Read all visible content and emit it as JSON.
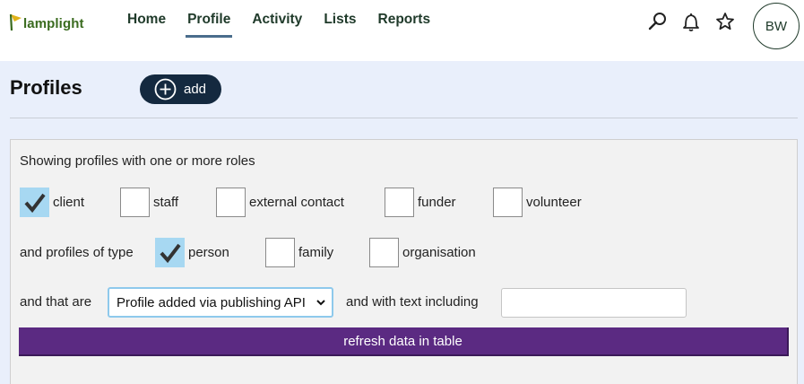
{
  "brand": {
    "name": "lamplight",
    "color": "#3a6b1f"
  },
  "nav": {
    "items": [
      {
        "label": "Home",
        "active": false
      },
      {
        "label": "Profile",
        "active": true
      },
      {
        "label": "Activity",
        "active": false
      },
      {
        "label": "Lists",
        "active": false
      },
      {
        "label": "Reports",
        "active": false
      }
    ]
  },
  "topbar_icons": [
    "search-icon",
    "bell-icon",
    "star-icon"
  ],
  "user": {
    "initials": "BW"
  },
  "header": {
    "title": "Profiles",
    "add_label": "add"
  },
  "filters": {
    "intro": "Showing profiles with one or more roles",
    "roles": [
      {
        "label": "client",
        "checked": true
      },
      {
        "label": "staff",
        "checked": false
      },
      {
        "label": "external contact",
        "checked": false
      },
      {
        "label": "funder",
        "checked": false
      },
      {
        "label": "volunteer",
        "checked": false
      }
    ],
    "type_label": "and profiles of type",
    "types": [
      {
        "label": "person",
        "checked": true
      },
      {
        "label": "family",
        "checked": false
      },
      {
        "label": "organisation",
        "checked": false
      }
    ],
    "status_label": "and that are",
    "status_selected": "Profile added via publishing API",
    "text_label": "and with text including",
    "text_value": "",
    "refresh_label": "refresh data in table"
  },
  "colors": {
    "accent_purple": "#5b2a82",
    "navy": "#14293f",
    "check_bg": "#a7d8f2",
    "band_bg": "#e9effb"
  }
}
